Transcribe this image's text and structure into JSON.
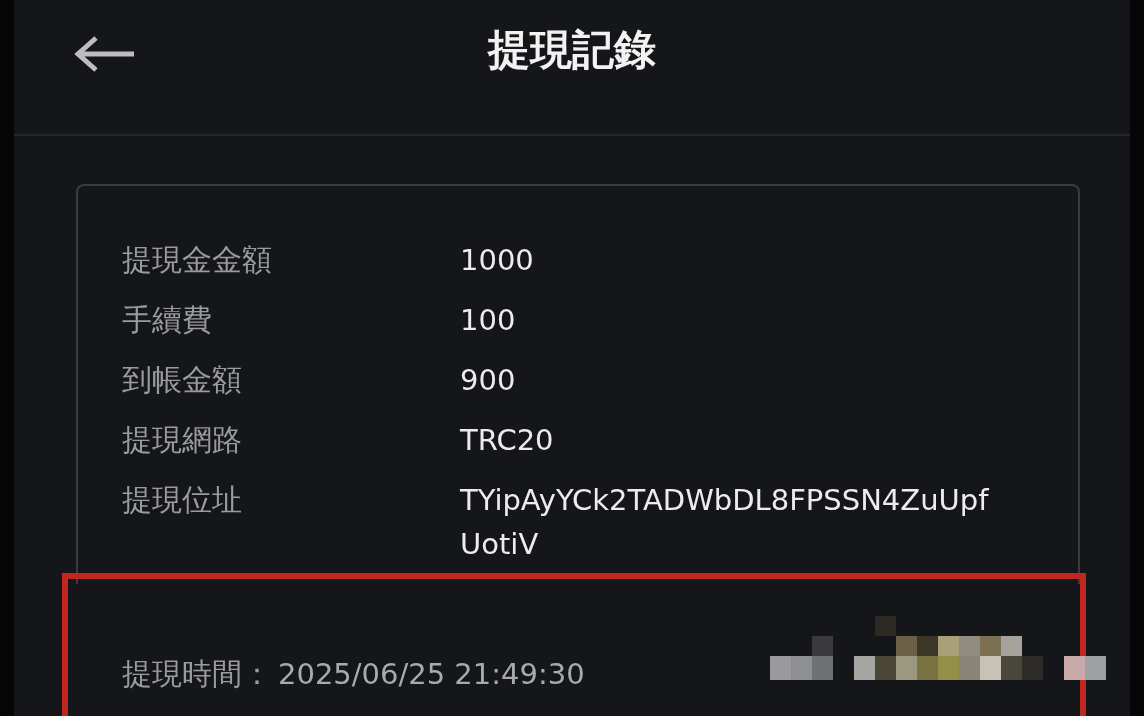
{
  "header": {
    "title": "提現記錄"
  },
  "details": [
    {
      "label": "提現金金額",
      "value_lines": [
        "1000"
      ]
    },
    {
      "label": "手續費",
      "value_lines": [
        "100"
      ]
    },
    {
      "label": "到帳金額",
      "value_lines": [
        "900"
      ]
    },
    {
      "label": "提現網路",
      "value_lines": [
        "TRC20"
      ]
    },
    {
      "label": "提現位址",
      "value_lines": [
        "TYipAyYCk2TADWbDL8FPSSN4ZuUpf",
        "UotiV"
      ]
    }
  ],
  "time": {
    "label": "提現時間：",
    "value": "2025/06/25 21:49:30"
  }
}
